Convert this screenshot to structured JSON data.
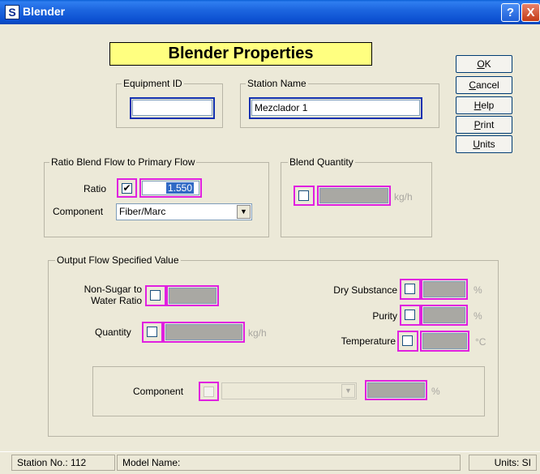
{
  "window": {
    "title": "Blender",
    "icon": "S",
    "help_glyph": "?",
    "close_glyph": "X"
  },
  "banner": "Blender Properties",
  "buttons": {
    "ok": "OK",
    "cancel": "Cancel",
    "help": "Help",
    "print": "Print",
    "units": "Units"
  },
  "equipment": {
    "group_label": "Equipment ID",
    "value": ""
  },
  "station": {
    "group_label": "Station Name",
    "value": "Mezclador 1"
  },
  "ratio_group": {
    "label": "Ratio Blend Flow to Primary Flow",
    "ratio_label": "Ratio",
    "ratio_checked": true,
    "ratio_value": "1.550",
    "component_label": "Component",
    "component_value": "Fiber/Marc"
  },
  "blend_quantity": {
    "label": "Blend Quantity",
    "unit": "kg/h"
  },
  "output_group": {
    "label": "Output Flow Specified Value",
    "non_sugar_label": "Non-Sugar to Water Ratio",
    "quantity_label": "Quantity",
    "quantity_unit": "kg/h",
    "dry_substance_label": "Dry Substance",
    "dry_substance_unit": "%",
    "purity_label": "Purity",
    "purity_unit": "%",
    "temperature_label": "Temperature",
    "temperature_unit": "°C",
    "component_label": "Component",
    "component_unit": "%"
  },
  "status": {
    "station_no": "Station No.: 112",
    "model_name": "Model Name:",
    "units": "Units: SI"
  },
  "icons": {
    "checkmark": "✔",
    "dropdown": "▼"
  }
}
